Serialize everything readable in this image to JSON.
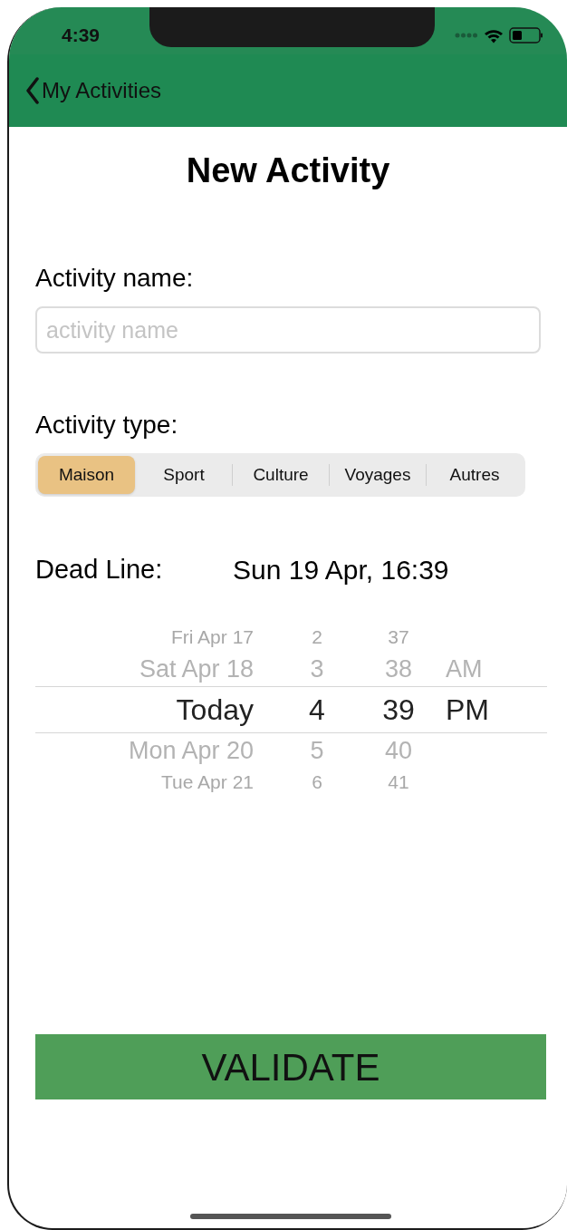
{
  "status_bar": {
    "time": "4:39"
  },
  "nav_bar": {
    "back_label": "My Activities"
  },
  "title": "New Activity",
  "name_field": {
    "label": "Activity name:",
    "placeholder": "activity name"
  },
  "type_field": {
    "label": "Activity type:",
    "segments": [
      {
        "label": "Maison",
        "selected": true
      },
      {
        "label": "Sport",
        "selected": false
      },
      {
        "label": "Culture",
        "selected": false
      },
      {
        "label": "Voyages",
        "selected": false
      },
      {
        "label": "Autres",
        "selected": false
      }
    ]
  },
  "deadline": {
    "label": "Dead Line:",
    "value": "Sun 19 Apr, 16:39"
  },
  "picker": {
    "rows": [
      {
        "date": "Fri Apr 17",
        "hour": "2",
        "minute": "37",
        "period": "",
        "selected": false
      },
      {
        "date": "Sat Apr 18",
        "hour": "3",
        "minute": "38",
        "period": "AM",
        "selected": false
      },
      {
        "date": "Today",
        "hour": "4",
        "minute": "39",
        "period": "PM",
        "selected": true
      },
      {
        "date": "Mon Apr 20",
        "hour": "5",
        "minute": "40",
        "period": "",
        "selected": false
      },
      {
        "date": "Tue Apr 21",
        "hour": "6",
        "minute": "41",
        "period": "",
        "selected": false
      }
    ]
  },
  "validate_button": {
    "label": "VALIDATE"
  }
}
